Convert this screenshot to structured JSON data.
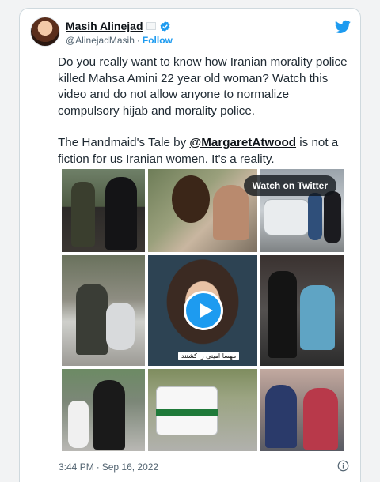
{
  "author": {
    "name": "Masih Alinejad",
    "handle": "@AlinejadMasih",
    "separator": "·",
    "follow_label": "Follow"
  },
  "tweet": {
    "paragraph1": "Do you really want to know how Iranian morality police killed Mahsa Amini 22 year old woman? Watch this video and do not allow anyone to normalize compulsory hijab and morality police.",
    "paragraph2_before": "The Handmaid's Tale by ",
    "mention": "@MargaretAtwood",
    "paragraph2_after": " is not a fiction for us Iranian women. It's a reality."
  },
  "media": {
    "watch_label": "Watch on Twitter",
    "video_caption": "مهسا امینی را کشتند"
  },
  "meta": {
    "time": "3:44 PM",
    "separator": "·",
    "date": "Sep 16, 2022"
  },
  "colors": {
    "accent": "#1d9bf0",
    "text": "#0f1419",
    "muted": "#536471"
  },
  "icons": {
    "verified": "verified-badge-icon",
    "brand": "twitter-bird-icon",
    "play": "play-icon",
    "info": "info-icon"
  }
}
